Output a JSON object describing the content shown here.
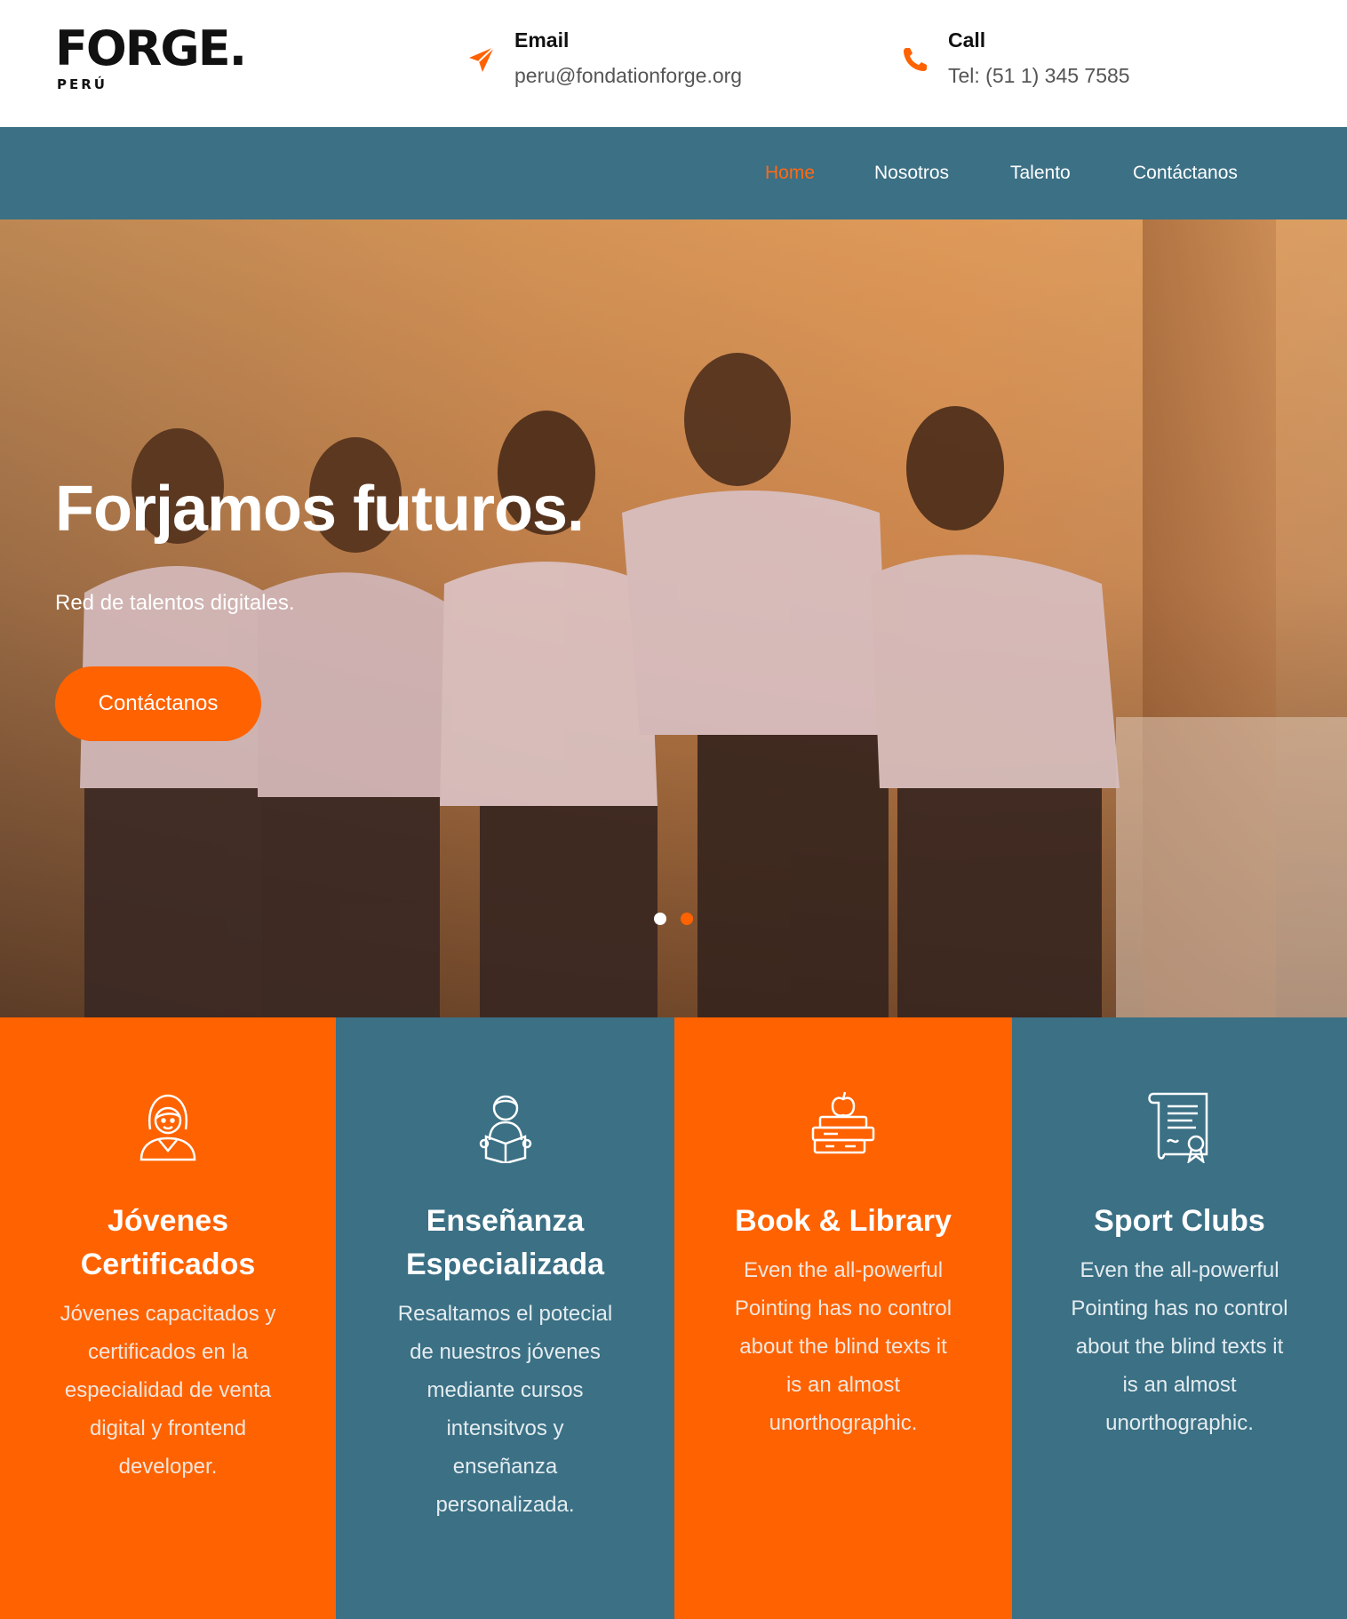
{
  "brand": {
    "name": "FORGE.",
    "country": "PERÚ"
  },
  "header": {
    "email": {
      "label": "Email",
      "value": "peru@fondationforge.org",
      "icon": "paper-plane-icon"
    },
    "call": {
      "label": "Call",
      "value": "Tel: (51 1) 345 7585",
      "icon": "phone-icon"
    }
  },
  "nav": {
    "items": [
      {
        "label": "Home",
        "active": true
      },
      {
        "label": "Nosotros",
        "active": false
      },
      {
        "label": "Talento",
        "active": false
      },
      {
        "label": "Contáctanos",
        "active": false
      }
    ]
  },
  "hero": {
    "title": "Forjamos futuros.",
    "subtitle": "Red de talentos digitales.",
    "button": "Contáctanos",
    "slides": 2,
    "active_slide": 2
  },
  "features": [
    {
      "icon": "graduate-girl-icon",
      "title_line1": "Jóvenes",
      "title_line2": "Certificados",
      "description": [
        "Jóvenes capacitados y",
        "certificados en la",
        "especialidad de venta",
        "digital y frontend",
        "developer."
      ]
    },
    {
      "icon": "student-reading-icon",
      "title_line1": "Enseñanza",
      "title_line2": "Especializada",
      "description": [
        "Resaltamos el potecial",
        "de nuestros jóvenes",
        "mediante cursos",
        "intensitvos y",
        "enseñanza",
        "personalizada."
      ]
    },
    {
      "icon": "books-apple-icon",
      "title_line1": "Book & Library",
      "title_line2": "",
      "description": [
        "Even the all-powerful",
        "Pointing has no control",
        "about the blind texts it",
        "is an almost",
        "unorthographic."
      ]
    },
    {
      "icon": "certificate-icon",
      "title_line1": "Sport Clubs",
      "title_line2": "",
      "description": [
        "Even the all-powerful",
        "Pointing has no control",
        "about the blind texts it",
        "is an almost",
        "unorthographic."
      ]
    }
  ],
  "colors": {
    "accent": "#ff6200",
    "primary": "#3b7085",
    "white": "#ffffff"
  }
}
